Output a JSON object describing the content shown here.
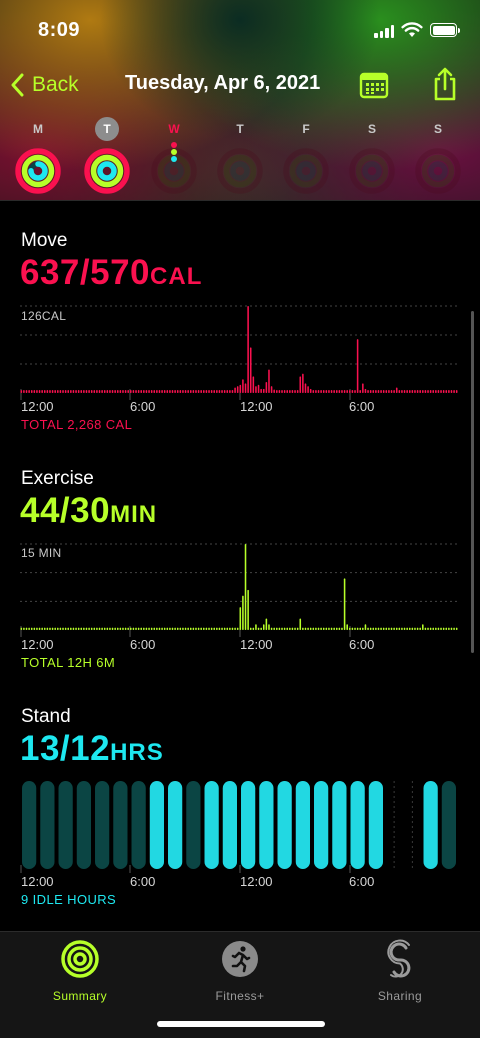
{
  "status_bar": {
    "time": "8:09"
  },
  "nav": {
    "back_label": "Back",
    "title": "Tuesday, Apr 6, 2021"
  },
  "week": [
    {
      "label": "M",
      "state": "past",
      "move": 1.0,
      "exercise": 1.0,
      "stand": 0.75
    },
    {
      "label": "T",
      "state": "selected",
      "move": 1.0,
      "exercise": 1.0,
      "stand": 1.0
    },
    {
      "label": "W",
      "state": "today",
      "move": 0.0,
      "exercise": 0.0,
      "stand": 0.0
    },
    {
      "label": "T",
      "state": "future",
      "move": 0.0,
      "exercise": 0.0,
      "stand": 0.0
    },
    {
      "label": "F",
      "state": "future",
      "move": 0.0,
      "exercise": 0.0,
      "stand": 0.0
    },
    {
      "label": "S",
      "state": "future",
      "move": 0.0,
      "exercise": 0.0,
      "stand": 0.0
    },
    {
      "label": "S",
      "state": "future",
      "move": 0.0,
      "exercise": 0.0,
      "stand": 0.0
    }
  ],
  "colors": {
    "move": "#fa114f",
    "move_dim": "#4a0a1c",
    "exercise": "#b7ff29",
    "exercise_dim": "#2d4a0a",
    "stand": "#1ee8f0",
    "stand_dim": "#0b4544",
    "stand_bright": "#22d8e2",
    "accent": "#b7ff29"
  },
  "move": {
    "title": "Move",
    "value": "637/570",
    "unit": "CAL",
    "max_label": "126CAL",
    "ticks": [
      "12:00",
      "6:00",
      "12:00",
      "6:00"
    ],
    "total": "TOTAL 2,268 CAL"
  },
  "exercise": {
    "title": "Exercise",
    "value": "44/30",
    "unit": "MIN",
    "max_label": "15 MIN",
    "ticks": [
      "12:00",
      "6:00",
      "12:00",
      "6:00"
    ],
    "total": "TOTAL 12H 6M"
  },
  "stand": {
    "title": "Stand",
    "value": "13/12",
    "unit": "HRS",
    "ticks": [
      "12:00",
      "6:00",
      "12:00",
      "6:00"
    ],
    "idle": "9 IDLE HOURS"
  },
  "chart_data": [
    {
      "type": "bar",
      "name": "Move",
      "unit": "CAL",
      "ymax": 126,
      "x_ticks": [
        "12:00",
        "6:00",
        "12:00",
        "6:00"
      ],
      "values": [
        1,
        1,
        1,
        1,
        1,
        1,
        1,
        1,
        1,
        1,
        1,
        1,
        1,
        1,
        1,
        1,
        1,
        1,
        1,
        1,
        1,
        1,
        1,
        1,
        1,
        1,
        1,
        1,
        1,
        1,
        1,
        1,
        1,
        1,
        1,
        1,
        1,
        1,
        1,
        1,
        1,
        1,
        1,
        1,
        1,
        1,
        1,
        1,
        1,
        1,
        1,
        1,
        1,
        1,
        1,
        1,
        1,
        1,
        1,
        2,
        2,
        2,
        2,
        2,
        1,
        1,
        1,
        2,
        2,
        1,
        1,
        2,
        2,
        2,
        2,
        2,
        2,
        2,
        2,
        3,
        3,
        2,
        8,
        10,
        12,
        20,
        14,
        126,
        66,
        24,
        10,
        12,
        6,
        6,
        16,
        34,
        10,
        5,
        4,
        3,
        3,
        2,
        2,
        2,
        2,
        3,
        3,
        24,
        28,
        14,
        10,
        6,
        4,
        3,
        2,
        2,
        3,
        3,
        3,
        3,
        2,
        2,
        3,
        3,
        3,
        3,
        3,
        3,
        2,
        78,
        3,
        14,
        6,
        3,
        3,
        2,
        2,
        2,
        2,
        2,
        3,
        3,
        2,
        2,
        8,
        2,
        2,
        2,
        2,
        2,
        2,
        2,
        2,
        2,
        2,
        2,
        2,
        2,
        2,
        2,
        2,
        2,
        2,
        2,
        2,
        2,
        2,
        2
      ],
      "total": "TOTAL 2,268 CAL"
    },
    {
      "type": "bar",
      "name": "Exercise",
      "unit": "MIN",
      "ymax": 15,
      "x_ticks": [
        "12:00",
        "6:00",
        "12:00",
        "6:00"
      ],
      "values": [
        0,
        0,
        0,
        0,
        0,
        0,
        0,
        0,
        0,
        0,
        0,
        0,
        0,
        0,
        0,
        0,
        0,
        0,
        0,
        0,
        0,
        0,
        0,
        0,
        0,
        0,
        0,
        0,
        0,
        0,
        0,
        0,
        0,
        0,
        0,
        0,
        0,
        0,
        0,
        0,
        0,
        0,
        0,
        0,
        0,
        0,
        0,
        0,
        0,
        0,
        0,
        0,
        0,
        0,
        0,
        0,
        0,
        0,
        0,
        0,
        0,
        0,
        0,
        0,
        0,
        0,
        0,
        0,
        0,
        0,
        0,
        0,
        0,
        0,
        0,
        0,
        0,
        0,
        0,
        0,
        0,
        0,
        0,
        0,
        4,
        6,
        15,
        7,
        0,
        0,
        1,
        0,
        0,
        1,
        2,
        1,
        0,
        0,
        0,
        0,
        0,
        0,
        0,
        0,
        0,
        0,
        0,
        2,
        0,
        0,
        0,
        0,
        0,
        0,
        0,
        0,
        0,
        0,
        0,
        0,
        0,
        0,
        0,
        0,
        9,
        1,
        0,
        0,
        0,
        0,
        0,
        0,
        1,
        0,
        0,
        0,
        0,
        0,
        0,
        0,
        0,
        0,
        0,
        0,
        0,
        0,
        0,
        0,
        0,
        0,
        0,
        0,
        0,
        0,
        1,
        0,
        0,
        0,
        0,
        0,
        0,
        0,
        0,
        0,
        0,
        0,
        0,
        0
      ],
      "total": "TOTAL 12H 6M"
    },
    {
      "type": "bar",
      "name": "Stand",
      "unit": "HRS",
      "x_ticks": [
        "12:00",
        "6:00",
        "12:00",
        "6:00"
      ],
      "hours": [
        0,
        0,
        0,
        0,
        0,
        0,
        0,
        1,
        1,
        0,
        1,
        1,
        1,
        1,
        1,
        1,
        1,
        1,
        1,
        1,
        null,
        null,
        1,
        0
      ],
      "idle": "9 IDLE HOURS"
    }
  ],
  "tabs": [
    {
      "label": "Summary",
      "icon": "summary-rings-icon",
      "active": true
    },
    {
      "label": "Fitness+",
      "icon": "running-figure-icon",
      "active": false
    },
    {
      "label": "Sharing",
      "icon": "sharing-icon",
      "active": false
    }
  ]
}
